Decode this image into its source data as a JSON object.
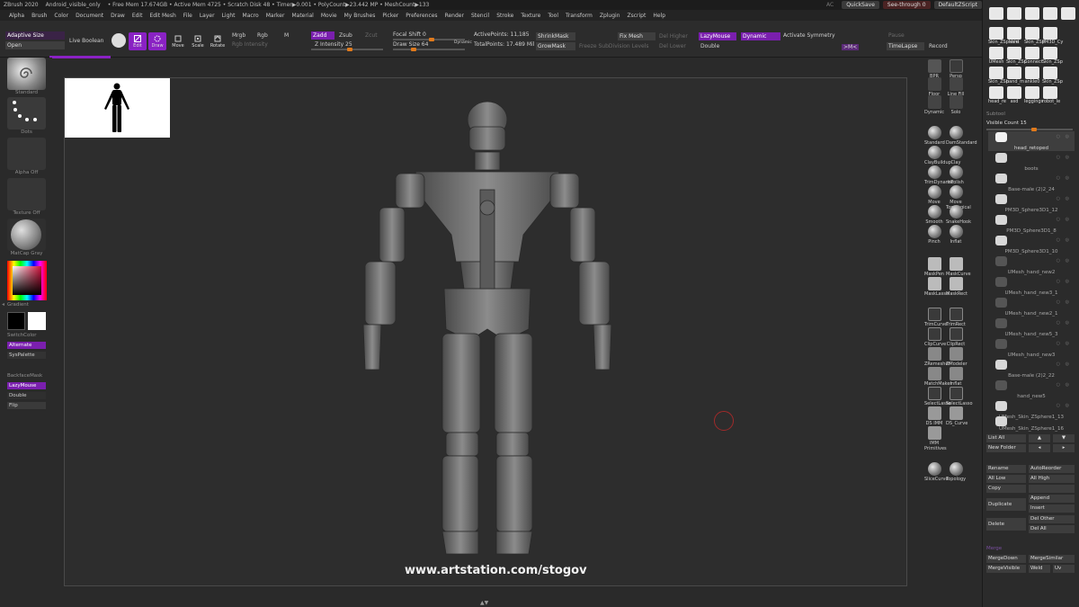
{
  "titlebar": {
    "app": "ZBrush 2020",
    "doc": "Android_visible_only",
    "stats": "• Free Mem 17.674GB • Active Mem 4725 • Scratch Disk 48 • Timer▶0.001 • PolyCount▶23.442 MP • MeshCount▶133",
    "quicksave": "QuickSave",
    "seethrough": "See-through  0",
    "script": "DefaultZScript",
    "ac": "AC"
  },
  "menubar": [
    "Alpha",
    "Brush",
    "Color",
    "Document",
    "Draw",
    "Edit",
    "Edit Mesh",
    "File",
    "Layer",
    "Light",
    "Macro",
    "Marker",
    "Material",
    "Movie",
    "My Brushes",
    "Picker",
    "Preferences",
    "Render",
    "Stencil",
    "Stroke",
    "Texture",
    "Tool",
    "Transform",
    "Zplugin",
    "Zscript",
    "Help"
  ],
  "toolbar": {
    "adaptive_size": "Adaptive Size",
    "open": "Open",
    "live_boolean": "Live Boolean",
    "edit": "Edit",
    "draw": "Draw",
    "move": "Move",
    "scale": "Scale",
    "rotate": "Rotate",
    "mrgb": "Mrgb",
    "rgb": "Rgb",
    "m": "M",
    "rgb_intensity": "Rgb Intensity",
    "zadd": "Zadd",
    "zsub": "Zsub",
    "zcut": "Zcut",
    "z_intensity": "Z Intensity 25",
    "focal_shift": "Focal Shift 0",
    "draw_size": "Draw Size 64",
    "dynamic_small": "Dynamic",
    "active_points": "ActivePoints: 11,185",
    "total_points": "TotalPoints: 17.489 Mil",
    "shrinkmask": "ShrinkMask",
    "growmask": "GrowMask",
    "freeze_subdiv": "Freeze SubDivision Levels",
    "fix_mesh": "Fix Mesh",
    "del_higher": "Del Higher",
    "del_lower": "Del Lower",
    "lazymouse": "LazyMouse",
    "dynamic": "Dynamic",
    "double": "Double",
    "activate_symmetry": "Activate Symmetry",
    "pause": "Pause",
    "timelapse": "TimeLapse",
    "record": "Record",
    "mx": ">M<"
  },
  "leftshelf": {
    "standard": "Standard",
    "dots": "Dots",
    "alpha_off": "Alpha Off",
    "texture_off": "Texture Off",
    "matcap": "MatCap Gray",
    "gradient": "Gradient",
    "switchcolor": "SwitchColor",
    "alternate": "Alternate",
    "syspalette": "SysPalette",
    "backfacemask": "BackfaceMask",
    "lazymouse": "LazyMouse",
    "double": "Double",
    "flip": "Flip"
  },
  "canvas": {
    "watermark": "www.artstation.com/stogov"
  },
  "rightshelf": {
    "top": [
      "BPR",
      "Persp",
      "Floor",
      "Line Fill",
      "Dynamic",
      "Solo",
      "Xpose"
    ],
    "brushes": [
      [
        "Standard",
        "DamStandard"
      ],
      [
        "ClayBuildup",
        "Clay"
      ],
      [
        "TrimDynamic",
        "hPolish"
      ],
      [
        "Move",
        "Move Topological"
      ],
      [
        "Smooth",
        "SnakeHook"
      ],
      [
        "Pinch",
        "Inflat"
      ],
      [
        "MaskPen",
        "MaskCurve"
      ],
      [
        "MaskLasso",
        "MaskRect"
      ],
      [
        "TrimCurve",
        "TrimRect"
      ],
      [
        "ClipCurve",
        "ClipRect"
      ],
      [
        "ZRemesher",
        "ZModeler"
      ],
      [
        "MatchMaker",
        "Inflat"
      ],
      [
        "SelectLasso",
        "SelectLasso"
      ],
      [
        "DS IMM",
        "DS_Curve"
      ],
      [
        "IMM Primitives",
        ""
      ],
      [
        "SliceCurve",
        "Topology"
      ]
    ]
  },
  "palette": {
    "thumbs_row1": [
      "",
      "",
      "",
      "",
      "",
      "",
      "",
      ""
    ],
    "thumbs_row2": [
      "Skin_ZSphere",
      "shirt",
      "Skin_ZSp",
      "PM3D_Cy",
      "",
      "",
      "",
      ""
    ],
    "thumbs_row3": [
      "UMesh",
      "",
      "Skin_ZSp",
      "Connect",
      "Skin_ZSp",
      "",
      "",
      ""
    ],
    "thumbs_row4": [
      "head_re",
      "asd",
      "leggings",
      "robot_le",
      "",
      "",
      "",
      ""
    ],
    "thumbs_row4b": [
      "Skin_ZSp",
      "hand_m",
      "ankle0",
      "Skin_ZSp"
    ],
    "subtool_header": "Subtool",
    "visible_count": "Visible Count 15",
    "subtools": [
      "head_retoped",
      "boots",
      "Base-male (2)2_24",
      "PM3D_Sphere3D1_12",
      "PM3D_Sphere3D1_8",
      "PM3D_Sphere3D1_10",
      "UMesh_hand_new2",
      "UMesh_hand_new3_1",
      "UMesh_hand_new2_1",
      "UMesh_hand_new5_3",
      "UMesh_hand_new3",
      "Base-male (2)2_22",
      "hand_new5",
      "UMesh_Skin_ZSphere1_13",
      "UMesh_Skin_ZSphere1_16"
    ],
    "list_all": "List All",
    "new_folder": "New Folder",
    "rename": "Rename",
    "autoreorder": "AutoReorder",
    "all_low": "All Low",
    "all_high": "All High",
    "copy": "Copy",
    "paste": "Paste",
    "duplicate": "Duplicate",
    "append": "Append",
    "insert": "Insert",
    "delete": "Delete",
    "del_other": "Del Other",
    "del_all": "Del All",
    "merge_header": "Merge",
    "mergedown": "MergeDown",
    "mergesimilar": "MergeSimilar",
    "mergevisible": "MergeVisible",
    "weld": "Weld",
    "uv": "Uv"
  },
  "colors": {
    "accent": "#8a22c4",
    "slider_knob": "#e07a1c",
    "canvas_bg": "#2d2d2d"
  }
}
